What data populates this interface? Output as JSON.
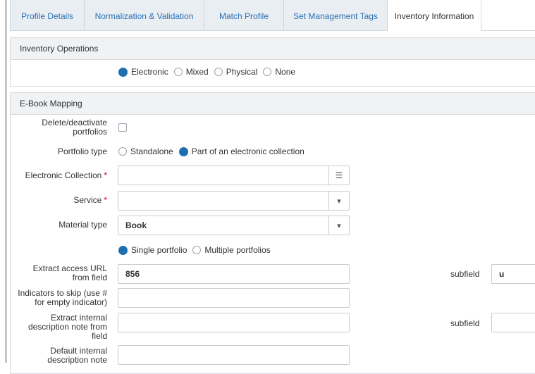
{
  "tabs": [
    {
      "label": "Profile Details"
    },
    {
      "label": "Normalization & Validation"
    },
    {
      "label": "Match Profile"
    },
    {
      "label": "Set Management Tags"
    },
    {
      "label": "Inventory Information"
    }
  ],
  "inventory_operations": {
    "title": "Inventory Operations",
    "options": [
      {
        "label": "Electronic",
        "selected": true
      },
      {
        "label": "Mixed",
        "selected": false
      },
      {
        "label": "Physical",
        "selected": false
      },
      {
        "label": "None",
        "selected": false
      }
    ]
  },
  "ebook_mapping": {
    "title": "E-Book Mapping",
    "delete_label": "Delete/deactivate portfolios",
    "portfolio_type_label": "Portfolio type",
    "portfolio_types": [
      {
        "label": "Standalone",
        "selected": false
      },
      {
        "label": "Part of an electronic collection",
        "selected": true
      }
    ],
    "electronic_collection_label": "Electronic Collection",
    "electronic_collection_value": "",
    "service_label": "Service",
    "service_value": "",
    "material_type_label": "Material type",
    "material_type_value": "Book",
    "portfolio_counts": [
      {
        "label": "Single portfolio",
        "selected": true
      },
      {
        "label": "Multiple portfolios",
        "selected": false
      }
    ],
    "extract_url_label": "Extract access URL from field",
    "extract_url_value": "856",
    "subfield_label": "subfield",
    "extract_url_subfield": "u",
    "indicators_label": "Indicators to skip (use # for empty indicator)",
    "indicators_value": "",
    "extract_note_label": "Extract internal description note from field",
    "extract_note_value": "",
    "extract_note_subfield": "",
    "default_note_label": "Default internal description note",
    "default_note_value": ""
  }
}
